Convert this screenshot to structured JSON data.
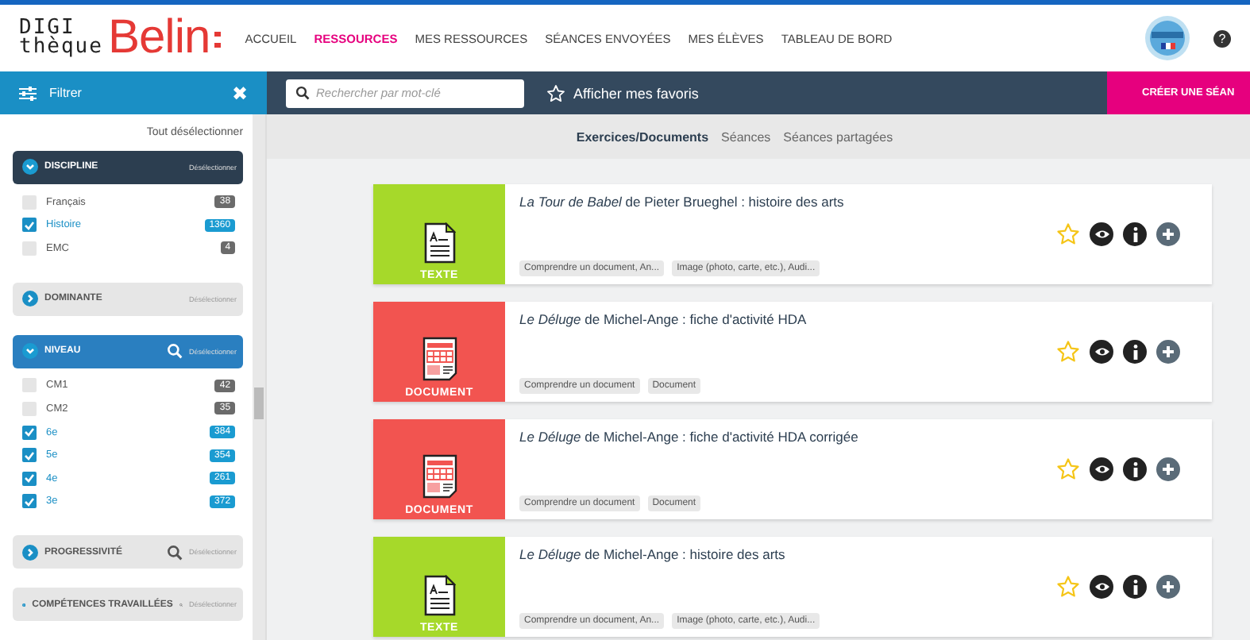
{
  "header": {
    "logo_top": "DIGI",
    "logo_bottom": "thèque",
    "logo_brand": "Belin",
    "nav": [
      {
        "label": "ACCUEIL",
        "selected": false
      },
      {
        "label": "RESSOURCES",
        "selected": true
      },
      {
        "label": "MES RESSOURCES",
        "selected": false
      },
      {
        "label": "SÉANCES ENVOYÉES",
        "selected": false
      },
      {
        "label": "MES ÉLÈVES",
        "selected": false
      },
      {
        "label": "TABLEAU DE BORD",
        "selected": false
      }
    ],
    "help": "?"
  },
  "toolbar": {
    "filter_label": "Filtrer",
    "close": "✖",
    "search": {
      "placeholder": "Rechercher par mot-clé"
    },
    "favorites": "Afficher mes favoris",
    "create_button": "CRÉER UNE SÉAN"
  },
  "sidebar": {
    "clear_all": "Tout désélectionner",
    "sections": [
      {
        "title": "DISCIPLINE",
        "expanded": true,
        "searchable": false,
        "color": "#2c3e50",
        "clear": "Désélectionner",
        "items": [
          {
            "label": "Français",
            "checked": false,
            "count": "38"
          },
          {
            "label": "Histoire",
            "checked": true,
            "count": "1360"
          },
          {
            "label": "EMC",
            "checked": false,
            "count": "4"
          }
        ]
      },
      {
        "title": "DOMINANTE",
        "expanded": false,
        "searchable": false,
        "color": "#e6e6e6",
        "clear": "Désélectionner"
      },
      {
        "title": "NIVEAU",
        "expanded": true,
        "searchable": true,
        "color": "#2a7fc0",
        "clear": "Désélectionner",
        "items": [
          {
            "label": "CM1",
            "checked": false,
            "count": "42"
          },
          {
            "label": "CM2",
            "checked": false,
            "count": "35"
          },
          {
            "label": "6e",
            "checked": true,
            "count": "384"
          },
          {
            "label": "5e",
            "checked": true,
            "count": "354"
          },
          {
            "label": "4e",
            "checked": true,
            "count": "261"
          },
          {
            "label": "3e",
            "checked": true,
            "count": "372"
          }
        ]
      },
      {
        "title": "PROGRESSIVITÉ",
        "expanded": false,
        "searchable": true,
        "color": "#e6e6e6",
        "clear": "Désélectionner"
      },
      {
        "title": "COMPÉTENCES TRAVAILLÉES",
        "expanded": false,
        "searchable": true,
        "color": "#e6e6e6",
        "clear": "Désélectionner"
      }
    ]
  },
  "tabs": [
    {
      "label": "Exercices/Documents",
      "selected": true
    },
    {
      "label": "Séances",
      "selected": false
    },
    {
      "label": "Séances partagées",
      "selected": false
    }
  ],
  "resources": [
    {
      "kind": "texte",
      "type_label": "TEXTE",
      "title": "*La Tour de Babel* de Pieter Brueghel : histoire des arts",
      "favorite": false,
      "tags": [
        "Comprendre un document, An...",
        "Image (photo, carte, etc.), Audi..."
      ]
    },
    {
      "kind": "document",
      "type_label": "DOCUMENT",
      "title": "*Le Déluge* de Michel-Ange : fiche d'activité HDA",
      "favorite": false,
      "tags": [
        "Comprendre un document",
        "Document"
      ]
    },
    {
      "kind": "document",
      "type_label": "DOCUMENT",
      "title": "*Le Déluge* de Michel-Ange : fiche d'activité HDA corrigée",
      "favorite": false,
      "tags": [
        "Comprendre un document",
        "Document"
      ]
    },
    {
      "kind": "texte",
      "type_label": "TEXTE",
      "title": "*Le Déluge* de Michel-Ange : histoire des arts",
      "favorite": false,
      "tags": [
        "Comprendre un document, An...",
        "Image (photo, carte, etc.), Audi..."
      ]
    }
  ]
}
